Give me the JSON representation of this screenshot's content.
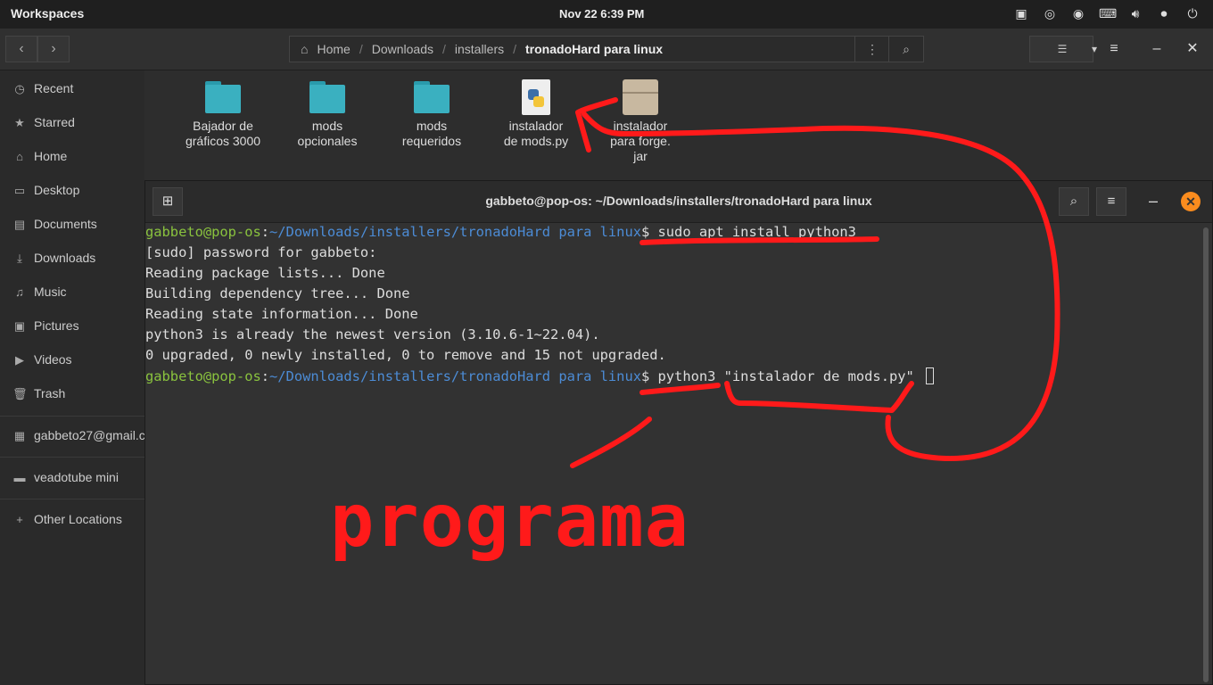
{
  "topbar": {
    "workspaces": "Workspaces",
    "datetime": "Nov 22   6:39 PM",
    "tray_icons": [
      "display-icon",
      "obs-icon",
      "discord-icon",
      "keyboard-icon",
      "volume-icon",
      "mic-icon",
      "power-icon"
    ]
  },
  "files_header": {
    "path": [
      "Home",
      "Downloads",
      "installers",
      "tronadoHard para linux"
    ]
  },
  "sidebar": {
    "items": [
      "Recent",
      "Starred",
      "Home",
      "Desktop",
      "Documents",
      "Downloads",
      "Music",
      "Pictures",
      "Videos",
      "Trash"
    ],
    "accounts": [
      "gabbeto27@gmail.c..."
    ],
    "bookmarks": [
      "veadotube mini"
    ],
    "other": "Other Locations"
  },
  "files": [
    {
      "name": "Bajador de gráficos 3000",
      "l1": "Bajador de",
      "l2": "gráficos 3000",
      "type": "folder"
    },
    {
      "name": "mods opcionales",
      "l1": "mods",
      "l2": "opcionales",
      "type": "folder"
    },
    {
      "name": "mods requeridos",
      "l1": "mods",
      "l2": "requeridos",
      "type": "folder"
    },
    {
      "name": "instalador de mods.py",
      "l1": "instalador",
      "l2": "de mods.py",
      "type": "python"
    },
    {
      "name": "instalador para forge.jar",
      "l1": "instalador",
      "l2": "para forge.",
      "l3": "jar",
      "type": "jar"
    }
  ],
  "terminal": {
    "title": "gabbeto@pop-os: ~/Downloads/installers/tronadoHard para linux",
    "user": "gabbeto@pop-os",
    "colon": ":",
    "path": "~/Downloads/installers/tronadoHard para linux",
    "cmd1": "$ sudo apt install python3",
    "out": [
      "[sudo] password for gabbeto:",
      "Reading package lists... Done",
      "Building dependency tree... Done",
      "Reading state information... Done",
      "python3 is already the newest version (3.10.6-1~22.04).",
      "0 upgraded, 0 newly installed, 0 to remove and 15 not upgraded."
    ],
    "cmd2": "$ python3 \"instalador de mods.py\" "
  },
  "annotation": {
    "text": "programa",
    "color": "#ff1a1a"
  }
}
